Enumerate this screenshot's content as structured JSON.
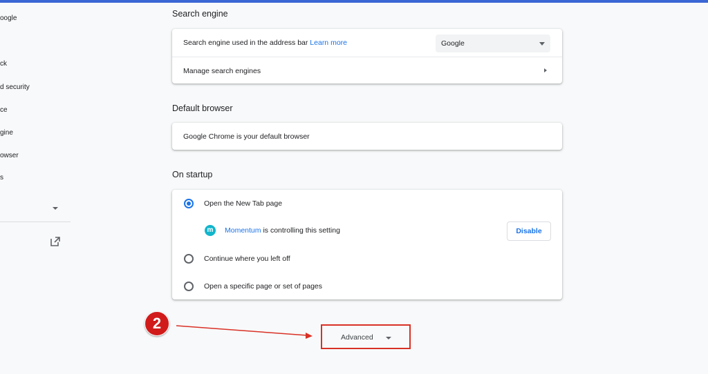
{
  "sidebar": {
    "items": [
      {
        "label": "oogle"
      },
      {
        "label": "ck"
      },
      {
        "label": "d security"
      },
      {
        "label": "ce"
      },
      {
        "label": "gine"
      },
      {
        "label": "owser"
      },
      {
        "label": "s"
      }
    ]
  },
  "search_engine": {
    "section_title": "Search engine",
    "used_label": "Search engine used in the address bar",
    "learn_more": "Learn more",
    "selected": "Google",
    "manage_label": "Manage search engines"
  },
  "default_browser": {
    "section_title": "Default browser",
    "status": "Google Chrome is your default browser"
  },
  "on_startup": {
    "section_title": "On startup",
    "options": [
      {
        "label": "Open the New Tab page",
        "selected": true
      },
      {
        "label": "Continue where you left off",
        "selected": false
      },
      {
        "label": "Open a specific page or set of pages",
        "selected": false
      }
    ],
    "extension": {
      "badge": "m",
      "name": "Momentum",
      "text": "is controlling this setting",
      "button": "Disable"
    }
  },
  "advanced": {
    "label": "Advanced"
  },
  "annotation": {
    "step": "2",
    "color": "#d11b1b"
  }
}
